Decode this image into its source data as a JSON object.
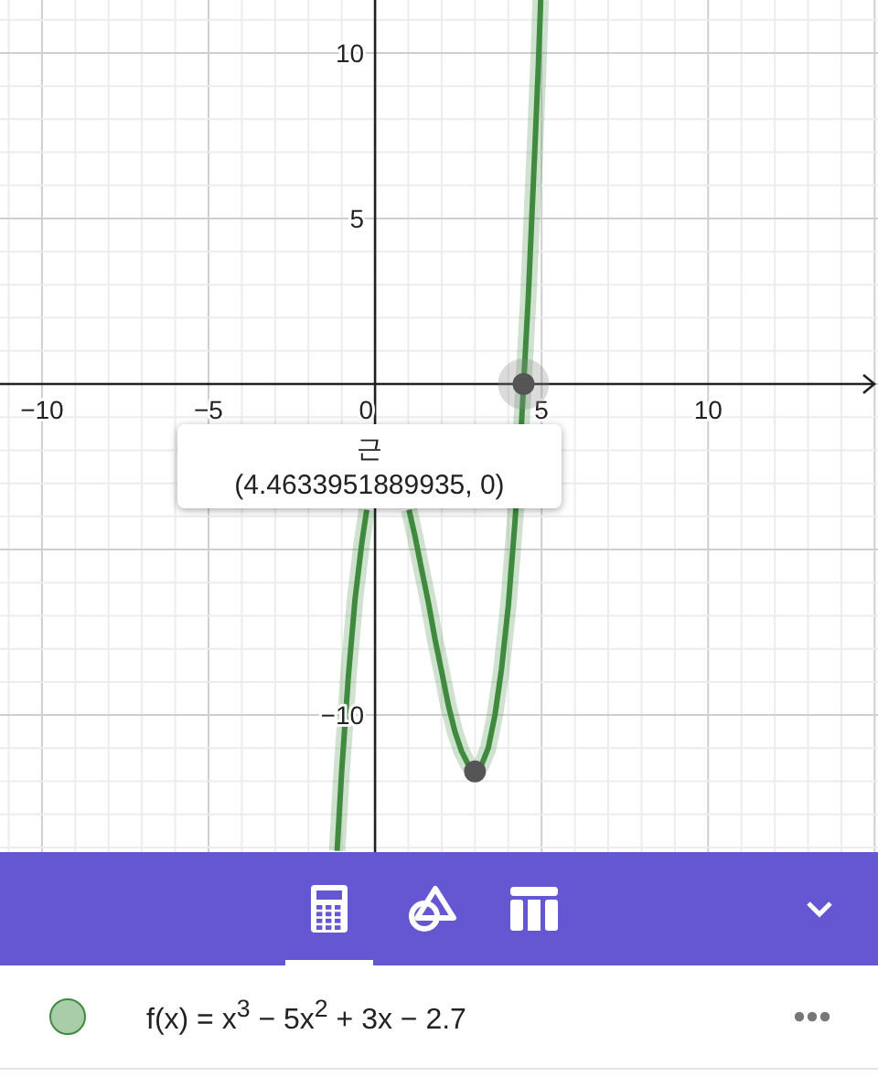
{
  "graph": {
    "chart_data": {
      "type": "line",
      "grid": true,
      "xlim": [
        -11.26,
        15.1
      ],
      "ylim": [
        -14.14,
        11.6
      ],
      "xticks": [
        -10,
        -5,
        0,
        5,
        10
      ],
      "yticks": [
        -10,
        5,
        10
      ],
      "x": [
        -1.14,
        -1.0,
        -0.8,
        -0.6,
        -0.4,
        -0.25,
        1.02,
        1.2,
        1.4,
        1.6,
        1.8,
        2.0,
        2.2,
        2.4,
        2.6,
        2.8,
        3.0,
        3.2,
        3.4,
        3.6,
        3.8,
        4.0,
        4.2,
        4.4,
        4.6,
        4.8,
        4.9,
        4.975
      ],
      "series": [
        {
          "color": "#3f8a3f",
          "values": [
            -14.1,
            -11.7,
            -8.8,
            -6.5,
            -4.8,
            -3.8,
            -3.8,
            -4.6,
            -5.6,
            -6.6,
            -7.7,
            -8.7,
            -9.7,
            -10.5,
            -11.1,
            -11.5,
            -11.7,
            -11.5,
            -11.0,
            -10.0,
            -8.6,
            -6.7,
            -4.2,
            -1.1,
            2.6,
            7.1,
            9.6,
            11.6
          ]
        }
      ]
    },
    "points": [
      {
        "kind": "root",
        "selected": true
      },
      {
        "kind": "minimum",
        "selected": false
      }
    ],
    "tooltip": {
      "title": "근",
      "value": "(4.4633951889935, 0)"
    }
  },
  "toolbar": {
    "tabs": [
      {
        "selected": true
      },
      {
        "selected": false
      },
      {
        "selected": false
      }
    ]
  },
  "algebra": [
    {
      "color": "#a9cda9",
      "expression": "f(x) = x$^{3}$ − 5x$^{2}$ + 3x − 2.7"
    }
  ]
}
